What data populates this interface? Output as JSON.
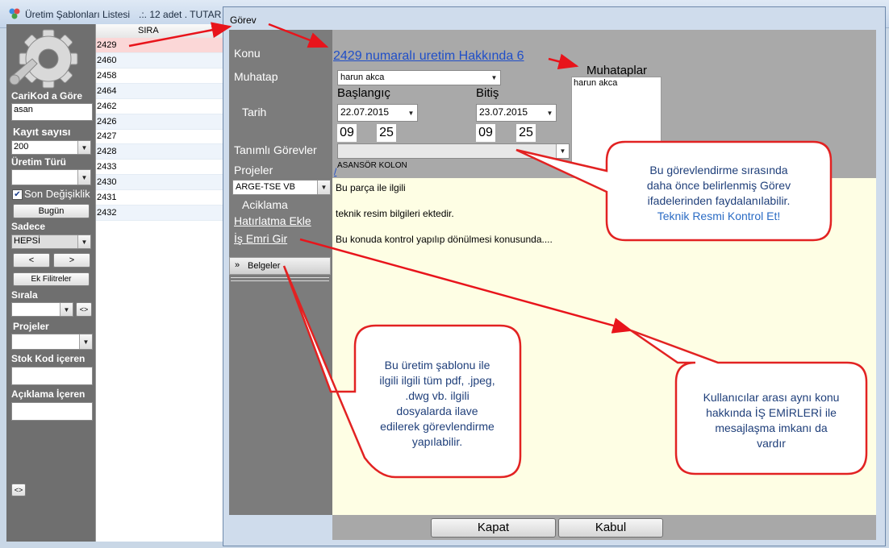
{
  "outer_window": {
    "title": "Üretim Şablonları Listesi",
    "count": ".:.   12 adet . TUTAR"
  },
  "filters": {
    "carikod_label": "CariKod a Göre",
    "carikod_value": "asan",
    "kayit_label": "Kayıt sayısı",
    "kayit_value": "200",
    "uretim_turu_label": "Üretim Türü",
    "son_degisiklik_label": "Son Değişiklik",
    "bugun_label": "Bugün",
    "sadece_label": "Sadece",
    "sadece_value": "HEPSİ",
    "prev_label": "<",
    "next_label": ">",
    "ek_filtreler_label": "Ek Filitreler",
    "sirala_label": "Sırala",
    "sirala_toggle": "<>",
    "projeler_label": "Projeler",
    "stok_kod_label": "Stok Kod içeren",
    "aciklama_label": "Açıklama İçeren",
    "collapse_label": "<>"
  },
  "grid": {
    "column_header": "SIRA",
    "rows": [
      "2429",
      "2460",
      "2458",
      "2464",
      "2462",
      "2426",
      "2427",
      "2428",
      "2433",
      "2430",
      "2431",
      "2432"
    ]
  },
  "dialog": {
    "title": "Görev",
    "konu_label": "Konu",
    "konu_link": "2429  numaralı uretim  Hakkında  6",
    "muhatap_label": "Muhatap",
    "muhatap_value": "harun akca",
    "muhataplar_label": "Muhataplar",
    "muhataplar_items": [
      "harun akca"
    ],
    "tarih_label": "Tarih",
    "baslangic_label": "Başlangıç",
    "baslangic_date": "22.07.2015",
    "baslangic_hour": "09",
    "baslangic_minute": "25",
    "bitis_label": "Bitiş",
    "bitis_date": "23.07.2015",
    "bitis_hour": "09",
    "bitis_minute": "25",
    "tanimli_label": "Tanımlı Görevler",
    "tanimli_value": "",
    "projeler_label": "Projeler",
    "projeler_value": "ARGE-TSE VB",
    "project_sub": "ASANSÖR KOLON",
    "slash_link": "/",
    "aciklama_label": "Aciklama",
    "hatirlatma_link": "Hatırlatma Ekle",
    "is_emri_link": "İş Emri Gir",
    "belgeler_label": "Belgeler",
    "description_lines": [
      "Bu parça ile ilgili",
      "teknik resim bilgileri ektedir.",
      "Bu konuda kontrol yapılıp dönülmesi konusunda...."
    ],
    "kapat_label": "Kapat",
    "kabul_label": "Kabul"
  },
  "callouts": {
    "c1_lines": [
      "Bu görevlendirme sırasında",
      "daha önce belirlenmiş Görev",
      "ifadelerinden faydalanılabilir."
    ],
    "c1_highlight": "Teknik Resmi Kontrol Et!",
    "c2_lines": [
      "Bu üretim şablonu ile",
      "ilgili ilgili tüm pdf, .jpeg,",
      ".dwg vb. ilgili",
      "dosyalarda ilave",
      "edilerek görevlendirme",
      "yapılabilir."
    ],
    "c3_lines": [
      "Kullanıcılar arası aynı konu",
      "hakkında İŞ EMİRLERİ ile",
      "mesajlaşma imkanı da",
      "vardır"
    ]
  },
  "colors": {
    "arrow": "#e8141b",
    "callout_border": "#e22222",
    "callout_text": "#1f3f7a",
    "link": "#1f4ec8"
  }
}
